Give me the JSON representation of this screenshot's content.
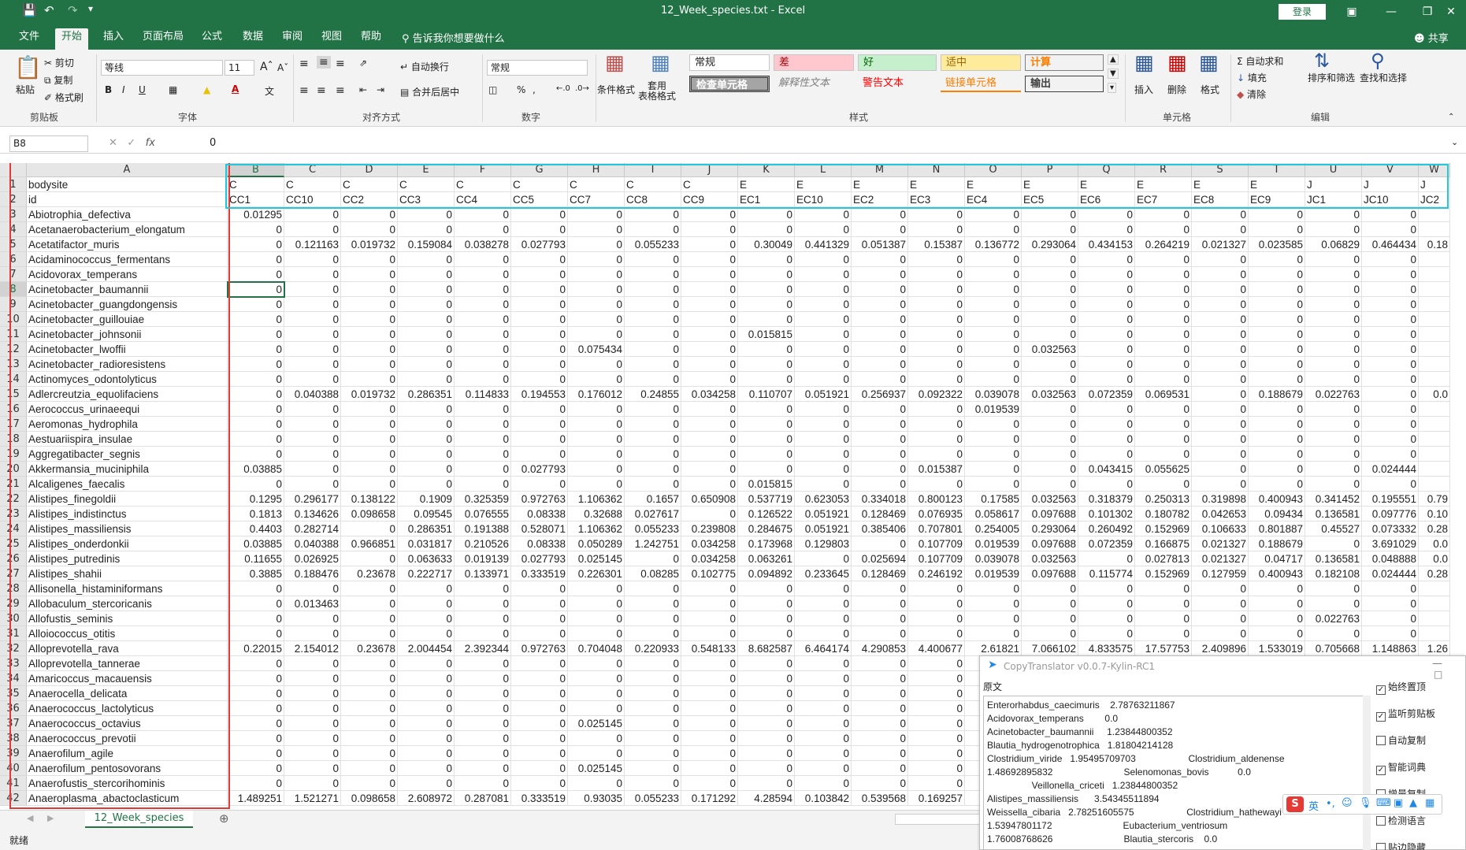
{
  "window": {
    "title": "12_Week_species.txt  -  Excel",
    "login": "登录"
  },
  "menu": {
    "tabs": [
      "文件",
      "开始",
      "插入",
      "页面布局",
      "公式",
      "数据",
      "审阅",
      "视图",
      "帮助"
    ],
    "tell_me": "告诉我你想要做什么",
    "share": "共享"
  },
  "ribbon": {
    "clipboard": {
      "paste": "粘贴",
      "cut": "剪切",
      "copy": "复制",
      "format_painter": "格式刷",
      "label": "剪贴板"
    },
    "font": {
      "name": "等线",
      "size": "11",
      "label": "字体"
    },
    "alignment": {
      "wrap": "自动换行",
      "merge": "合并后居中",
      "label": "对齐方式"
    },
    "number": {
      "format": "常规",
      "label": "数字"
    },
    "styles": {
      "conditional": "条件格式",
      "table": "套用\n表格格式",
      "cells": [
        "常规",
        "差",
        "好",
        "适中",
        "计算",
        "检查单元格",
        "解释性文本",
        "警告文本",
        "链接单元格",
        "输出"
      ],
      "label": "样式"
    },
    "cells_group": {
      "insert": "插入",
      "delete": "删除",
      "format": "格式",
      "label": "单元格"
    },
    "editing": {
      "autosum": "自动求和",
      "fill": "填充",
      "clear": "清除",
      "sort": "排序和筛选",
      "find": "查找和选择",
      "label": "编辑"
    }
  },
  "formula_bar": {
    "name_box": "B8",
    "value": "0"
  },
  "sheet": {
    "columns": [
      "A",
      "B",
      "C",
      "D",
      "E",
      "F",
      "G",
      "H",
      "I",
      "J",
      "K",
      "L",
      "M",
      "N",
      "O",
      "P",
      "Q",
      "R",
      "S",
      "T",
      "U",
      "V",
      "W"
    ],
    "row_numbers": [
      "1",
      "2",
      "3",
      "4",
      "5",
      "6",
      "7",
      "8",
      "9",
      "10",
      "11",
      "12",
      "13",
      "14",
      "15",
      "16",
      "17",
      "18",
      "19",
      "20",
      "21",
      "22",
      "23",
      "24",
      "25",
      "26",
      "27",
      "28",
      "29",
      "30",
      "31",
      "32",
      "33",
      "34",
      "35",
      "36",
      "37",
      "38",
      "39",
      "40",
      "41",
      "42"
    ],
    "rows": [
      [
        "bodysite",
        "C",
        "C",
        "C",
        "C",
        "C",
        "C",
        "C",
        "C",
        "C",
        "E",
        "E",
        "E",
        "E",
        "E",
        "E",
        "E",
        "E",
        "E",
        "E",
        "J",
        "J",
        "J"
      ],
      [
        "id",
        "CC1",
        "CC10",
        "CC2",
        "CC3",
        "CC4",
        "CC5",
        "CC7",
        "CC8",
        "CC9",
        "EC1",
        "EC10",
        "EC2",
        "EC3",
        "EC4",
        "EC5",
        "EC6",
        "EC7",
        "EC8",
        "EC9",
        "JC1",
        "JC10",
        "JC2"
      ],
      [
        "Abiotrophia_defectiva",
        "0.01295",
        "0",
        "0",
        "0",
        "0",
        "0",
        "0",
        "0",
        "0",
        "0",
        "0",
        "0",
        "0",
        "0",
        "0",
        "0",
        "0",
        "0",
        "0",
        "0",
        "0",
        ""
      ],
      [
        "Acetanaerobacterium_elongatum",
        "0",
        "0",
        "0",
        "0",
        "0",
        "0",
        "0",
        "0",
        "0",
        "0",
        "0",
        "0",
        "0",
        "0",
        "0",
        "0",
        "0",
        "0",
        "0",
        "0",
        "0",
        ""
      ],
      [
        "Acetatifactor_muris",
        "0",
        "0.121163",
        "0.019732",
        "0.159084",
        "0.038278",
        "0.027793",
        "0",
        "0.055233",
        "0",
        "0.30049",
        "0.441329",
        "0.051387",
        "0.15387",
        "0.136772",
        "0.293064",
        "0.434153",
        "0.264219",
        "0.021327",
        "0.023585",
        "0.06829",
        "0.464434",
        "0.18"
      ],
      [
        "Acidaminococcus_fermentans",
        "0",
        "0",
        "0",
        "0",
        "0",
        "0",
        "0",
        "0",
        "0",
        "0",
        "0",
        "0",
        "0",
        "0",
        "0",
        "0",
        "0",
        "0",
        "0",
        "0",
        "0",
        ""
      ],
      [
        "Acidovorax_temperans",
        "0",
        "0",
        "0",
        "0",
        "0",
        "0",
        "0",
        "0",
        "0",
        "0",
        "0",
        "0",
        "0",
        "0",
        "0",
        "0",
        "0",
        "0",
        "0",
        "0",
        "0",
        ""
      ],
      [
        "Acinetobacter_baumannii",
        "0",
        "0",
        "0",
        "0",
        "0",
        "0",
        "0",
        "0",
        "0",
        "0",
        "0",
        "0",
        "0",
        "0",
        "0",
        "0",
        "0",
        "0",
        "0",
        "0",
        "0",
        ""
      ],
      [
        "Acinetobacter_guangdongensis",
        "0",
        "0",
        "0",
        "0",
        "0",
        "0",
        "0",
        "0",
        "0",
        "0",
        "0",
        "0",
        "0",
        "0",
        "0",
        "0",
        "0",
        "0",
        "0",
        "0",
        "0",
        ""
      ],
      [
        "Acinetobacter_guillouiae",
        "0",
        "0",
        "0",
        "0",
        "0",
        "0",
        "0",
        "0",
        "0",
        "0",
        "0",
        "0",
        "0",
        "0",
        "0",
        "0",
        "0",
        "0",
        "0",
        "0",
        "0",
        ""
      ],
      [
        "Acinetobacter_johnsonii",
        "0",
        "0",
        "0",
        "0",
        "0",
        "0",
        "0",
        "0",
        "0",
        "0.015815",
        "0",
        "0",
        "0",
        "0",
        "0",
        "0",
        "0",
        "0",
        "0",
        "0",
        "0",
        ""
      ],
      [
        "Acinetobacter_lwoffii",
        "0",
        "0",
        "0",
        "0",
        "0",
        "0",
        "0.075434",
        "0",
        "0",
        "0",
        "0",
        "0",
        "0",
        "0",
        "0.032563",
        "0",
        "0",
        "0",
        "0",
        "0",
        "0",
        ""
      ],
      [
        "Acinetobacter_radioresistens",
        "0",
        "0",
        "0",
        "0",
        "0",
        "0",
        "0",
        "0",
        "0",
        "0",
        "0",
        "0",
        "0",
        "0",
        "0",
        "0",
        "0",
        "0",
        "0",
        "0",
        "0",
        ""
      ],
      [
        "Actinomyces_odontolyticus",
        "0",
        "0",
        "0",
        "0",
        "0",
        "0",
        "0",
        "0",
        "0",
        "0",
        "0",
        "0",
        "0",
        "0",
        "0",
        "0",
        "0",
        "0",
        "0",
        "0",
        "0",
        ""
      ],
      [
        "Adlercreutzia_equolifaciens",
        "0",
        "0.040388",
        "0.019732",
        "0.286351",
        "0.114833",
        "0.194553",
        "0.176012",
        "0.24855",
        "0.034258",
        "0.110707",
        "0.051921",
        "0.256937",
        "0.092322",
        "0.039078",
        "0.032563",
        "0.072359",
        "0.069531",
        "0",
        "0.188679",
        "0.022763",
        "0",
        "0.0"
      ],
      [
        "Aerococcus_urinaeequi",
        "0",
        "0",
        "0",
        "0",
        "0",
        "0",
        "0",
        "0",
        "0",
        "0",
        "0",
        "0",
        "0",
        "0.019539",
        "0",
        "0",
        "0",
        "0",
        "0",
        "0",
        "0",
        ""
      ],
      [
        "Aeromonas_hydrophila",
        "0",
        "0",
        "0",
        "0",
        "0",
        "0",
        "0",
        "0",
        "0",
        "0",
        "0",
        "0",
        "0",
        "0",
        "0",
        "0",
        "0",
        "0",
        "0",
        "0",
        "0",
        ""
      ],
      [
        "Aestuariispira_insulae",
        "0",
        "0",
        "0",
        "0",
        "0",
        "0",
        "0",
        "0",
        "0",
        "0",
        "0",
        "0",
        "0",
        "0",
        "0",
        "0",
        "0",
        "0",
        "0",
        "0",
        "0",
        ""
      ],
      [
        "Aggregatibacter_segnis",
        "0",
        "0",
        "0",
        "0",
        "0",
        "0",
        "0",
        "0",
        "0",
        "0",
        "0",
        "0",
        "0",
        "0",
        "0",
        "0",
        "0",
        "0",
        "0",
        "0",
        "0",
        ""
      ],
      [
        "Akkermansia_muciniphila",
        "0.03885",
        "0",
        "0",
        "0",
        "0",
        "0.027793",
        "0",
        "0",
        "0",
        "0",
        "0",
        "0",
        "0.015387",
        "0",
        "0",
        "0.043415",
        "0.055625",
        "0",
        "0",
        "0",
        "0.024444",
        ""
      ],
      [
        "Alcaligenes_faecalis",
        "0",
        "0",
        "0",
        "0",
        "0",
        "0",
        "0",
        "0",
        "0",
        "0.015815",
        "0",
        "0",
        "0",
        "0",
        "0",
        "0",
        "0",
        "0",
        "0",
        "0",
        "0",
        ""
      ],
      [
        "Alistipes_finegoldii",
        "0.1295",
        "0.296177",
        "0.138122",
        "0.1909",
        "0.325359",
        "0.972763",
        "1.106362",
        "0.1657",
        "0.650908",
        "0.537719",
        "0.623053",
        "0.334018",
        "0.800123",
        "0.17585",
        "0.032563",
        "0.318379",
        "0.250313",
        "0.319898",
        "0.400943",
        "0.341452",
        "0.195551",
        "0.79"
      ],
      [
        "Alistipes_indistinctus",
        "0.1813",
        "0.134626",
        "0.098658",
        "0.09545",
        "0.076555",
        "0.08338",
        "0.32688",
        "0.027617",
        "0",
        "0.126522",
        "0.051921",
        "0.128469",
        "0.076935",
        "0.058617",
        "0.097688",
        "0.101302",
        "0.180782",
        "0.042653",
        "0.09434",
        "0.136581",
        "0.097776",
        "0.10"
      ],
      [
        "Alistipes_massiliensis",
        "0.4403",
        "0.282714",
        "0",
        "0.286351",
        "0.191388",
        "0.528071",
        "1.106362",
        "0.055233",
        "0.239808",
        "0.284675",
        "0.051921",
        "0.385406",
        "0.707801",
        "0.254005",
        "0.293064",
        "0.260492",
        "0.152969",
        "0.106633",
        "0.801887",
        "0.45527",
        "0.073332",
        "0.28"
      ],
      [
        "Alistipes_onderdonkii",
        "0.03885",
        "0.040388",
        "0.966851",
        "0.031817",
        "0.210526",
        "0.08338",
        "0.050289",
        "1.242751",
        "0.034258",
        "0.173968",
        "0.129803",
        "0",
        "0.107709",
        "0.019539",
        "0.097688",
        "0.072359",
        "0.166875",
        "0.021327",
        "0.188679",
        "0",
        "3.691029",
        "0.0"
      ],
      [
        "Alistipes_putredinis",
        "0.11655",
        "0.026925",
        "0",
        "0.063633",
        "0.019139",
        "0.027793",
        "0.025145",
        "0",
        "0.034258",
        "0.063261",
        "0",
        "0.025694",
        "0.107709",
        "0.039078",
        "0.032563",
        "0",
        "0.027813",
        "0.021327",
        "0.04717",
        "0.136581",
        "0.048888",
        "0.0"
      ],
      [
        "Alistipes_shahii",
        "0.3885",
        "0.188476",
        "0.23678",
        "0.222717",
        "0.133971",
        "0.333519",
        "0.226301",
        "0.08285",
        "0.102775",
        "0.094892",
        "0.233645",
        "0.128469",
        "0.246192",
        "0.019539",
        "0.097688",
        "0.115774",
        "0.152969",
        "0.127959",
        "0.400943",
        "0.182108",
        "0.024444",
        "0.28"
      ],
      [
        "Allisonella_histaminiformans",
        "0",
        "0",
        "0",
        "0",
        "0",
        "0",
        "0",
        "0",
        "0",
        "0",
        "0",
        "0",
        "0",
        "0",
        "0",
        "0",
        "0",
        "0",
        "0",
        "0",
        "0",
        ""
      ],
      [
        "Allobaculum_stercoricanis",
        "0",
        "0.013463",
        "0",
        "0",
        "0",
        "0",
        "0",
        "0",
        "0",
        "0",
        "0",
        "0",
        "0",
        "0",
        "0",
        "0",
        "0",
        "0",
        "0",
        "0",
        "0",
        ""
      ],
      [
        "Allofustis_seminis",
        "0",
        "0",
        "0",
        "0",
        "0",
        "0",
        "0",
        "0",
        "0",
        "0",
        "0",
        "0",
        "0",
        "0",
        "0",
        "0",
        "0",
        "0",
        "0",
        "0.022763",
        "0",
        ""
      ],
      [
        "Alloiococcus_otitis",
        "0",
        "0",
        "0",
        "0",
        "0",
        "0",
        "0",
        "0",
        "0",
        "0",
        "0",
        "0",
        "0",
        "0",
        "0",
        "0",
        "0",
        "0",
        "0",
        "0",
        "0",
        ""
      ],
      [
        "Alloprevotella_rava",
        "0.22015",
        "2.154012",
        "0.23678",
        "2.004454",
        "2.392344",
        "0.972763",
        "0.704048",
        "0.220933",
        "0.548133",
        "8.682587",
        "6.464174",
        "4.290853",
        "4.400677",
        "2.61821",
        "7.066102",
        "4.833575",
        "17.57753",
        "2.409896",
        "1.533019",
        "0.705668",
        "1.148863",
        "1.26"
      ],
      [
        "Alloprevotella_tannerae",
        "0",
        "0",
        "0",
        "0",
        "0",
        "0",
        "0",
        "0",
        "0",
        "0",
        "0",
        "0",
        "0",
        "",
        "",
        "",
        "",
        "",
        "",
        "",
        "",
        ""
      ],
      [
        "Amaricoccus_macauensis",
        "0",
        "0",
        "0",
        "0",
        "0",
        "0",
        "0",
        "0",
        "0",
        "0",
        "0",
        "0",
        "0",
        "",
        "",
        "",
        "",
        "",
        "",
        "",
        "",
        ""
      ],
      [
        "Anaerocella_delicata",
        "0",
        "0",
        "0",
        "0",
        "0",
        "0",
        "0",
        "0",
        "0",
        "0",
        "0",
        "0",
        "0",
        "",
        "",
        "",
        "",
        "",
        "",
        "",
        "",
        ""
      ],
      [
        "Anaerococcus_lactolyticus",
        "0",
        "0",
        "0",
        "0",
        "0",
        "0",
        "0",
        "0",
        "0",
        "0",
        "0",
        "0",
        "0",
        "",
        "",
        "",
        "",
        "",
        "",
        "",
        "",
        ""
      ],
      [
        "Anaerococcus_octavius",
        "0",
        "0",
        "0",
        "0",
        "0",
        "0",
        "0.025145",
        "0",
        "0",
        "0",
        "0",
        "0",
        "0",
        "",
        "",
        "",
        "",
        "",
        "",
        "",
        "",
        ""
      ],
      [
        "Anaerococcus_prevotii",
        "0",
        "0",
        "0",
        "0",
        "0",
        "0",
        "0",
        "0",
        "0",
        "0",
        "0",
        "0",
        "0",
        "",
        "",
        "",
        "",
        "",
        "",
        "",
        "",
        ""
      ],
      [
        "Anaerofilum_agile",
        "0",
        "0",
        "0",
        "0",
        "0",
        "0",
        "0",
        "0",
        "0",
        "0",
        "0",
        "0",
        "0",
        "",
        "",
        "",
        "",
        "",
        "",
        "",
        "",
        ""
      ],
      [
        "Anaerofilum_pentosovorans",
        "0",
        "0",
        "0",
        "0",
        "0",
        "0",
        "0.025145",
        "0",
        "0",
        "0",
        "0",
        "0",
        "0",
        "",
        "",
        "",
        "",
        "",
        "",
        "",
        "",
        ""
      ],
      [
        "Anaerofustis_stercorihominis",
        "0",
        "0",
        "0",
        "0",
        "0",
        "0",
        "0",
        "0",
        "0",
        "0",
        "0",
        "0",
        "0",
        "",
        "",
        "",
        "",
        "",
        "",
        "",
        "",
        ""
      ],
      [
        "Anaeroplasma_abactoclasticum",
        "1.489251",
        "1.521271",
        "0.098658",
        "2.608972",
        "0.287081",
        "0.333519",
        "0.93035",
        "0.055233",
        "0.171292",
        "4.28594",
        "0.103842",
        "0.539568",
        "0.169257",
        "",
        "",
        "",
        "",
        "",
        "",
        "",
        "",
        ""
      ]
    ]
  },
  "sheet_tab": "12_Week_species",
  "status": "就绪",
  "copytranslator": {
    "title": "CopyTranslator v0.0.7-Kylin-RC1",
    "source_label": "原文",
    "source_text": "Enterorhabdus_caecimuris    2.78763211867\nAcidovorax_temperans        0.0\nAcinetobacter_baumannii     1.23844800352\nBlautia_hydrogenotrophica   1.81804214128\nClostridium_viride   1.95495709703                    Clostridium_aldenense\n1.48692895832                           Selenomonas_bovis           0.0\n                 Veillonella_criceti   1.23844800352\nAlistipes_massiliensis      3.54345511894\nWeissella_cibaria   2.78251605575                    Clostridium_hathewayi\n1.53947801172                           Eubacterium_ventriosum\n1.76008768626                           Blautia_stercoris    0.0",
    "options": [
      "始终置顶",
      "监听剪贴板",
      "自动复制",
      "智能词典",
      "增量复制",
      "检测语言",
      "贴边隐藏"
    ],
    "checked": [
      true,
      true,
      false,
      true,
      false,
      false,
      false
    ]
  },
  "ime": {
    "label": "英"
  }
}
